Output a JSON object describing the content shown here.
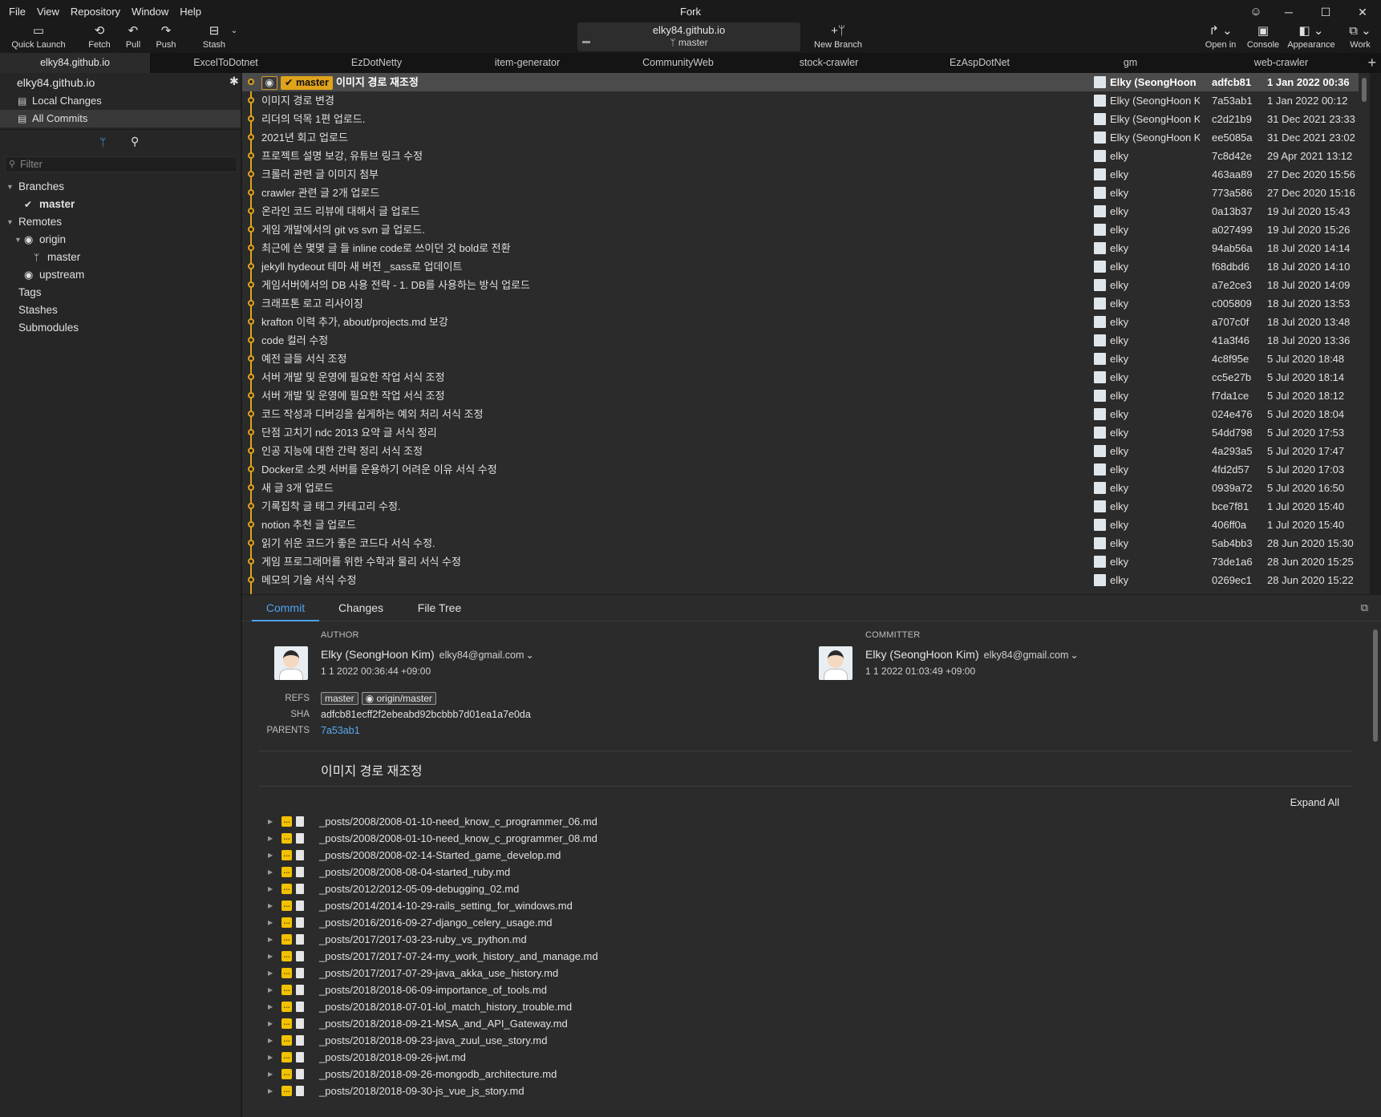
{
  "app_title": "Fork",
  "menu": [
    "File",
    "View",
    "Repository",
    "Window",
    "Help"
  ],
  "toolbar": {
    "quick_launch": "Quick Launch",
    "fetch": "Fetch",
    "pull": "Pull",
    "push": "Push",
    "stash": "Stash",
    "new_branch": "New Branch",
    "open_in": "Open in",
    "console": "Console",
    "appearance": "Appearance",
    "work": "Work"
  },
  "repo_selector": {
    "name": "elky84.github.io",
    "branch": "master"
  },
  "tabs": [
    "elky84.github.io",
    "ExcelToDotnet",
    "EzDotNetty",
    "item-generator",
    "CommunityWeb",
    "stock-crawler",
    "EzAspDotNet",
    "gm",
    "web-crawler"
  ],
  "sidebar": {
    "repo_name": "elky84.github.io",
    "local_changes": "Local Changes",
    "all_commits": "All Commits",
    "filter_placeholder": "Filter",
    "branches": "Branches",
    "branch_master": "master",
    "remotes": "Remotes",
    "origin": "origin",
    "origin_master": "master",
    "upstream": "upstream",
    "tags": "Tags",
    "stashes": "Stashes",
    "submodules": "Submodules"
  },
  "commit_list": {
    "head_badge": "master",
    "commits": [
      {
        "msg": "이미지 경로 재조정",
        "author": "Elky (SeongHoon Kim)",
        "sha": "adfcb81",
        "date": "1 Jan 2022 00:36"
      },
      {
        "msg": "이미지 경로 변경",
        "author": "Elky (SeongHoon Kim)",
        "sha": "7a53ab1",
        "date": "1 Jan 2022 00:12"
      },
      {
        "msg": "리더의 덕목 1편 업로드.",
        "author": "Elky (SeongHoon Kim)",
        "sha": "c2d21b9",
        "date": "31 Dec 2021 23:33"
      },
      {
        "msg": "2021년 회고 업로드",
        "author": "Elky (SeongHoon Kim)",
        "sha": "ee5085a",
        "date": "31 Dec 2021 23:02"
      },
      {
        "msg": "프로젝트 설명 보강, 유튜브 링크 수정",
        "author": "elky",
        "sha": "7c8d42e",
        "date": "29 Apr 2021 13:12"
      },
      {
        "msg": "크롤러 관련 글 이미지 첨부",
        "author": "elky",
        "sha": "463aa89",
        "date": "27 Dec 2020 15:56"
      },
      {
        "msg": "crawler 관련 글 2개 업로드",
        "author": "elky",
        "sha": "773a586",
        "date": "27 Dec 2020 15:16"
      },
      {
        "msg": "온라인 코드 리뷰에 대해서 글 업로드",
        "author": "elky",
        "sha": "0a13b37",
        "date": "19 Jul 2020 15:43"
      },
      {
        "msg": "게임 개발에서의 git vs svn 글 업로드.",
        "author": "elky",
        "sha": "a027499",
        "date": "19 Jul 2020 15:26"
      },
      {
        "msg": "최근에 쓴 몇몇 글 들 inline code로 쓰이던 것 bold로 전환",
        "author": "elky",
        "sha": "94ab56a",
        "date": "18 Jul 2020 14:14"
      },
      {
        "msg": "jekyll hydeout 테마 새 버전 _sass로 업데이트",
        "author": "elky",
        "sha": "f68dbd6",
        "date": "18 Jul 2020 14:10"
      },
      {
        "msg": "게임서버에서의 DB 사용 전략 - 1. DB를 사용하는 방식 업로드",
        "author": "elky",
        "sha": "a7e2ce3",
        "date": "18 Jul 2020 14:09"
      },
      {
        "msg": "크래프톤 로고 리사이징",
        "author": "elky",
        "sha": "c005809",
        "date": "18 Jul 2020 13:53"
      },
      {
        "msg": "krafton 이력 추가, about/projects.md 보강",
        "author": "elky",
        "sha": "a707c0f",
        "date": "18 Jul 2020 13:48"
      },
      {
        "msg": "code 컬러 수정",
        "author": "elky",
        "sha": "41a3f46",
        "date": "18 Jul 2020 13:36"
      },
      {
        "msg": "예전 글들 서식 조정",
        "author": "elky",
        "sha": "4c8f95e",
        "date": "5 Jul 2020 18:48"
      },
      {
        "msg": "서버 개발 및 운영에 필요한 작업 서식 조정",
        "author": "elky",
        "sha": "cc5e27b",
        "date": "5 Jul 2020 18:14"
      },
      {
        "msg": "서버 개발 및 운영에 필요한 작업 서식 조정",
        "author": "elky",
        "sha": "f7da1ce",
        "date": "5 Jul 2020 18:12"
      },
      {
        "msg": "코드 작성과 디버깅을 쉽게하는 예외 처리 서식 조정",
        "author": "elky",
        "sha": "024e476",
        "date": "5 Jul 2020 18:04"
      },
      {
        "msg": "단점 고치기 ndc 2013 요약 글 서식 정리",
        "author": "elky",
        "sha": "54dd798",
        "date": "5 Jul 2020 17:53"
      },
      {
        "msg": "인공 지능에 대한 간략 정리 서식 조정",
        "author": "elky",
        "sha": "4a293a5",
        "date": "5 Jul 2020 17:47"
      },
      {
        "msg": "Docker로 소켓 서버를 운용하기 어려운 이유 서식 수정",
        "author": "elky",
        "sha": "4fd2d57",
        "date": "5 Jul 2020 17:03"
      },
      {
        "msg": "새 글 3개 업로드",
        "author": "elky",
        "sha": "0939a72",
        "date": "5 Jul 2020 16:50"
      },
      {
        "msg": "기록집착 글 태그 카테고리 수정.",
        "author": "elky",
        "sha": "bce7f81",
        "date": "1 Jul 2020 15:40"
      },
      {
        "msg": "notion 추천 글 업로드",
        "author": "elky",
        "sha": "406ff0a",
        "date": "1 Jul 2020 15:40"
      },
      {
        "msg": "읽기 쉬운 코드가 좋은 코드다 서식 수정.",
        "author": "elky",
        "sha": "5ab4bb3",
        "date": "28 Jun 2020 15:30"
      },
      {
        "msg": "게임 프로그래머를 위한 수학과 물리 서식 수정",
        "author": "elky",
        "sha": "73de1a6",
        "date": "28 Jun 2020 15:25"
      },
      {
        "msg": "메모의 기술 서식 수정",
        "author": "elky",
        "sha": "0269ec1",
        "date": "28 Jun 2020 15:22"
      }
    ]
  },
  "detail": {
    "tabs": [
      "Commit",
      "Changes",
      "File Tree"
    ],
    "author_label": "AUTHOR",
    "committer_label": "COMMITTER",
    "author_name": "Elky (SeongHoon Kim)",
    "author_email": "elky84@gmail.com",
    "author_date": "1 1 2022 00:36:44 +09:00",
    "committer_name": "Elky (SeongHoon Kim)",
    "committer_email": "elky84@gmail.com",
    "committer_date": "1 1 2022 01:03:49 +09:00",
    "refs_label": "REFS",
    "sha_label": "SHA",
    "parents_label": "PARENTS",
    "ref1": "master",
    "ref2": "origin/master",
    "sha": "adfcb81ecff2f2ebeabd92bcbbb7d01ea1a7e0da",
    "parent": "7a53ab1",
    "subject": "이미지 경로 재조정",
    "expand_all": "Expand All",
    "files": [
      "_posts/2008/2008-01-10-need_know_c_programmer_06.md",
      "_posts/2008/2008-01-10-need_know_c_programmer_08.md",
      "_posts/2008/2008-02-14-Started_game_develop.md",
      "_posts/2008/2008-08-04-started_ruby.md",
      "_posts/2012/2012-05-09-debugging_02.md",
      "_posts/2014/2014-10-29-rails_setting_for_windows.md",
      "_posts/2016/2016-09-27-django_celery_usage.md",
      "_posts/2017/2017-03-23-ruby_vs_python.md",
      "_posts/2017/2017-07-24-my_work_history_and_manage.md",
      "_posts/2017/2017-07-29-java_akka_use_history.md",
      "_posts/2018/2018-06-09-importance_of_tools.md",
      "_posts/2018/2018-07-01-lol_match_history_trouble.md",
      "_posts/2018/2018-09-21-MSA_and_API_Gateway.md",
      "_posts/2018/2018-09-23-java_zuul_use_story.md",
      "_posts/2018/2018-09-26-jwt.md",
      "_posts/2018/2018-09-26-mongodb_architecture.md",
      "_posts/2018/2018-09-30-js_vue_js_story.md"
    ]
  }
}
